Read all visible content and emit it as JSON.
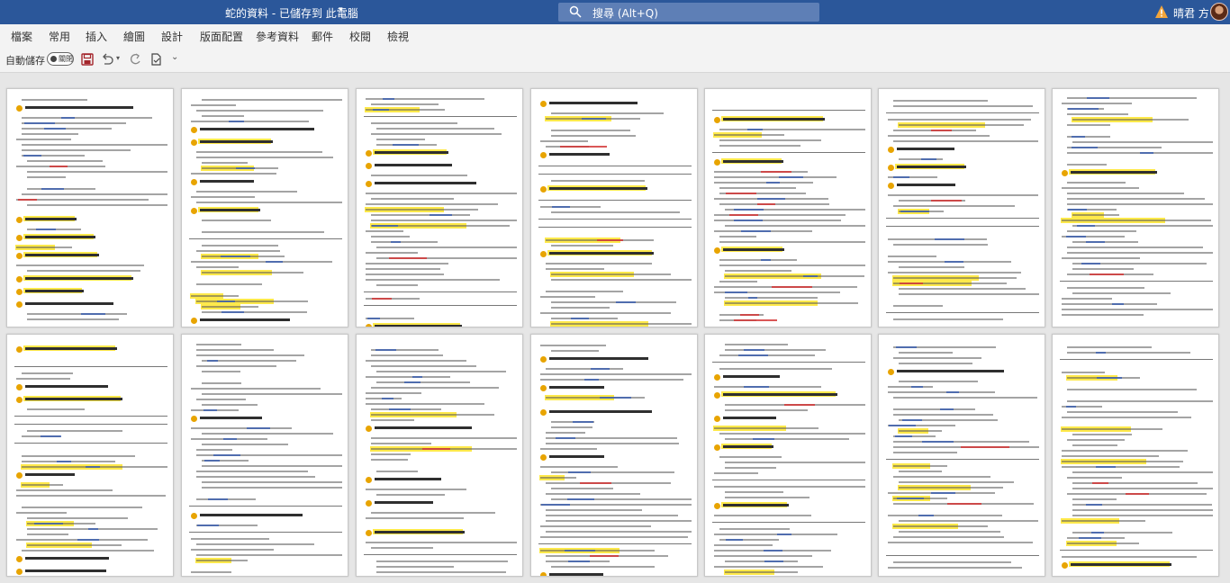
{
  "window": {
    "title": "蛇的資料 - 已儲存到 此電腦",
    "search_placeholder": "搜尋 (Alt+Q)",
    "user_name": "晴君 方",
    "accent": "#2b579a"
  },
  "menu": {
    "tabs": [
      "檔案",
      "常用",
      "插入",
      "繪圖",
      "設計",
      "版面配置",
      "參考資料",
      "郵件",
      "校閱",
      "檢視"
    ]
  },
  "quick_access": {
    "autosave_label": "自動儲存",
    "autosave_state": "關閉",
    "icons": [
      "save-icon",
      "undo-icon",
      "redo-icon",
      "document-check-icon",
      "customize-icon"
    ]
  },
  "document": {
    "view": "multi-page",
    "rows": 2,
    "columns": 7,
    "highlight_color": "#ffe94a",
    "number_bullet_color": "#e8a400"
  }
}
